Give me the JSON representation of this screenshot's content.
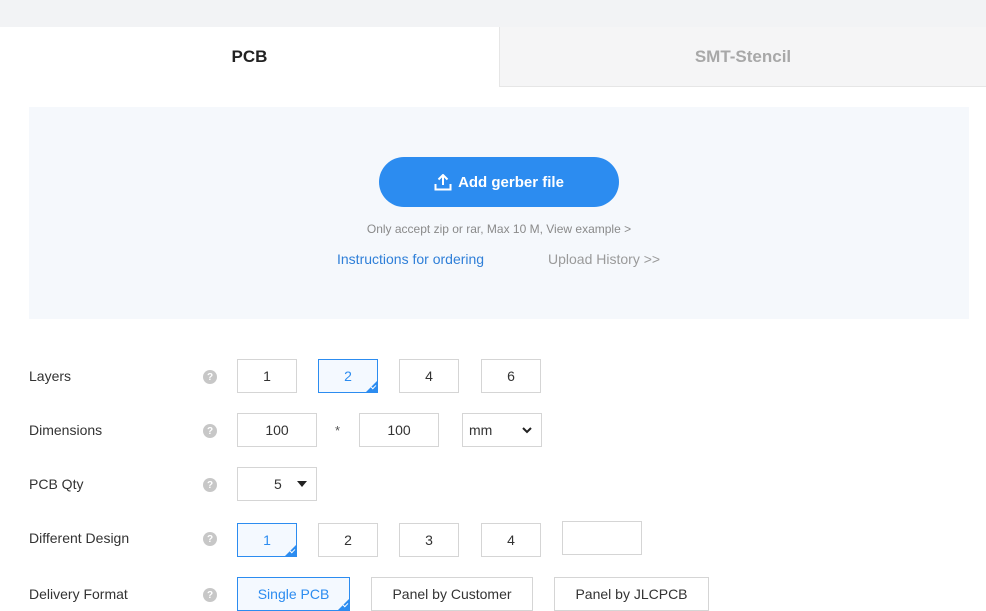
{
  "tabs": [
    {
      "label": "PCB",
      "active": true
    },
    {
      "label": "SMT-Stencil",
      "active": false
    }
  ],
  "upload": {
    "button_label": "Add gerber file",
    "note": "Only accept zip or rar, Max 10 M, View example >",
    "instructions_link": "Instructions for ordering",
    "history_link": "Upload History >>"
  },
  "form": {
    "layers": {
      "label": "Layers",
      "options": [
        "1",
        "2",
        "4",
        "6"
      ],
      "selected": "2"
    },
    "dimensions": {
      "label": "Dimensions",
      "width": "100",
      "separator": "*",
      "height": "100",
      "unit": "mm"
    },
    "pcb_qty": {
      "label": "PCB Qty",
      "value": "5"
    },
    "different_design": {
      "label": "Different Design",
      "options": [
        "1",
        "2",
        "3",
        "4"
      ],
      "selected": "1",
      "custom_value": ""
    },
    "delivery_format": {
      "label": "Delivery Format",
      "options": [
        "Single PCB",
        "Panel by Customer",
        "Panel by JLCPCB"
      ],
      "selected": "Single PCB"
    }
  },
  "colors": {
    "accent": "#2c8cf0",
    "link": "#2f7fd8",
    "upload_bg": "#f5f8fc"
  },
  "icons": {
    "upload": "upload-icon",
    "help": "question-mark-icon",
    "dropdown": "caret-down-icon"
  }
}
